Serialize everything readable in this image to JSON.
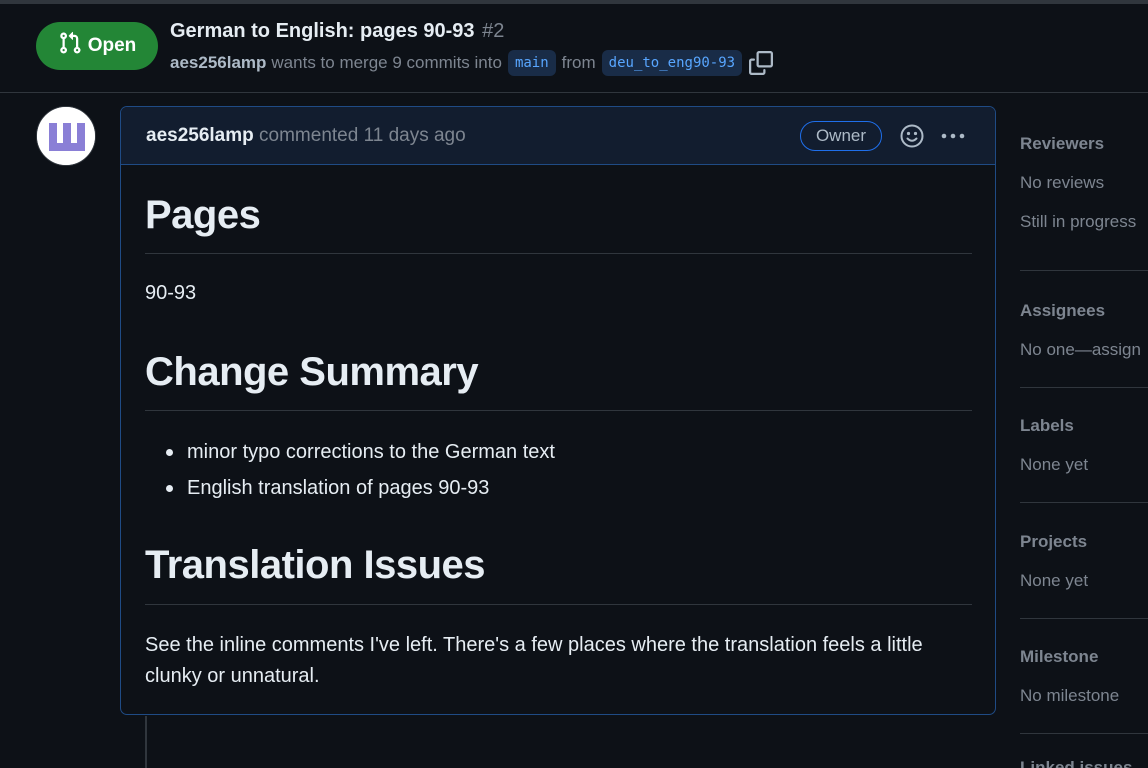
{
  "pr": {
    "state": "Open",
    "title": "German to English: pages 90-93",
    "number": "#2",
    "author": "aes256lamp",
    "merge_text": "wants to merge 9 commits into",
    "base_branch": "main",
    "from_text": "from",
    "head_branch": "deu_to_eng90-93"
  },
  "comment": {
    "author": "aes256lamp",
    "action": "commented 11 days ago",
    "role_badge": "Owner",
    "body": {
      "h_pages": "Pages",
      "pages_value": "90-93",
      "h_change": "Change Summary",
      "changes": [
        "minor typo corrections to the German text",
        "English translation of pages 90-93"
      ],
      "h_issues": "Translation Issues",
      "issues_text": "See the inline comments I've left. There's a few places where the translation feels a little clunky or unnatural."
    }
  },
  "sidebar": {
    "reviewers": {
      "heading": "Reviewers",
      "value": "No reviews",
      "value2": "Still in progress"
    },
    "assignees": {
      "heading": "Assignees",
      "value": "No one—assign"
    },
    "labels": {
      "heading": "Labels",
      "value": "None yet"
    },
    "projects": {
      "heading": "Projects",
      "value": "None yet"
    },
    "milestone": {
      "heading": "Milestone",
      "value": "No milestone"
    },
    "linked": {
      "heading": "Linked issues"
    }
  },
  "colors": {
    "background": "#0d1117",
    "open_green": "#238636",
    "accent_blue": "#58a6ff",
    "muted": "#7d8590",
    "border": "#30363d"
  },
  "icons": [
    "git-pull-request-icon",
    "copy-icon",
    "smiley-icon",
    "kebab-horizontal-icon"
  ]
}
